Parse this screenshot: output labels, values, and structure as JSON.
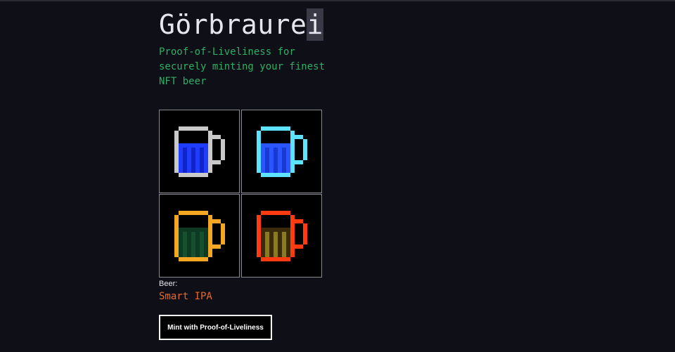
{
  "app": {
    "title_main": "Görbraure",
    "title_cursor_char": "i",
    "tagline": "Proof-of-Liveliness for securely minting your finest NFT beer"
  },
  "beers": [
    {
      "icon": "beer-mug-icon",
      "mug_color": "#c9c9c9",
      "liquid_color": "#1f3cff",
      "stripe_color": "#1024c8"
    },
    {
      "icon": "beer-mug-icon",
      "mug_color": "#5ee3ff",
      "liquid_color": "#2a55ff",
      "stripe_color": "#183ad0"
    },
    {
      "icon": "beer-mug-icon",
      "mug_color": "#f5a623",
      "liquid_color": "#0c3a22",
      "stripe_color": "#17502f"
    },
    {
      "icon": "beer-mug-icon",
      "mug_color": "#ff3b0f",
      "liquid_color": "#3a2a08",
      "stripe_color": "#8a7a20"
    }
  ],
  "selection": {
    "label": "Beer:",
    "name": "Smart IPA"
  },
  "mint_button": {
    "label": "Mint with Proof-of-Liveliness"
  }
}
